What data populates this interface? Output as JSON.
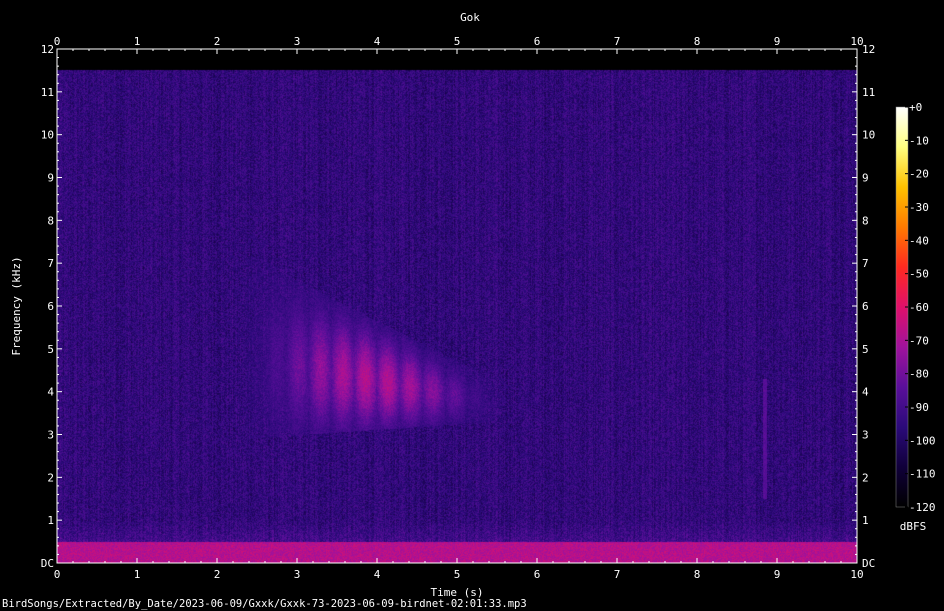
{
  "chart_data": {
    "type": "heatmap",
    "title": "Gok",
    "xlabel": "Time (s)",
    "ylabel": "Frequency (kHz)",
    "xlim": [
      0,
      10
    ],
    "ylim": [
      0,
      12
    ],
    "x_ticks": [
      "0",
      "1",
      "2",
      "3",
      "4",
      "5",
      "6",
      "7",
      "8",
      "9",
      "10"
    ],
    "y_ticks": [
      "DC",
      "1",
      "2",
      "3",
      "4",
      "5",
      "6",
      "7",
      "8",
      "9",
      "10",
      "11",
      "12"
    ],
    "colorbar": {
      "label": "dBFS",
      "ticks": [
        "+0",
        "-10",
        "-20",
        "-30",
        "-40",
        "-50",
        "-60",
        "-70",
        "-80",
        "-90",
        "-100",
        "-110",
        "-120"
      ],
      "range": [
        -120,
        0
      ],
      "colormap": [
        "#000000",
        "#10003a",
        "#2b0a7a",
        "#5a0f9a",
        "#a0129c",
        "#e0106a",
        "#ff2a20",
        "#ff7a00",
        "#ffc200",
        "#ffff80",
        "#ffffff"
      ]
    },
    "background_level_dbfs": -95,
    "content_cutoff_khz": 11.5,
    "low_band": {
      "khz_max": 0.5,
      "level_dbfs": -68
    },
    "call_events": [
      {
        "t_start": 2.35,
        "t_end": 5.55,
        "f_low": 2.3,
        "f_high": 7.2,
        "peak_dbfs": -70
      }
    ],
    "minor_events": [
      {
        "t": 8.85,
        "f_low": 1.5,
        "f_high": 4.3,
        "peak_dbfs": -85
      }
    ]
  },
  "footer": {
    "filename": "BirdSongs/Extracted/By_Date/2023-06-09/Gxxk/Gxxk-73-2023-06-09-birdnet-02:01:33.mp3"
  }
}
